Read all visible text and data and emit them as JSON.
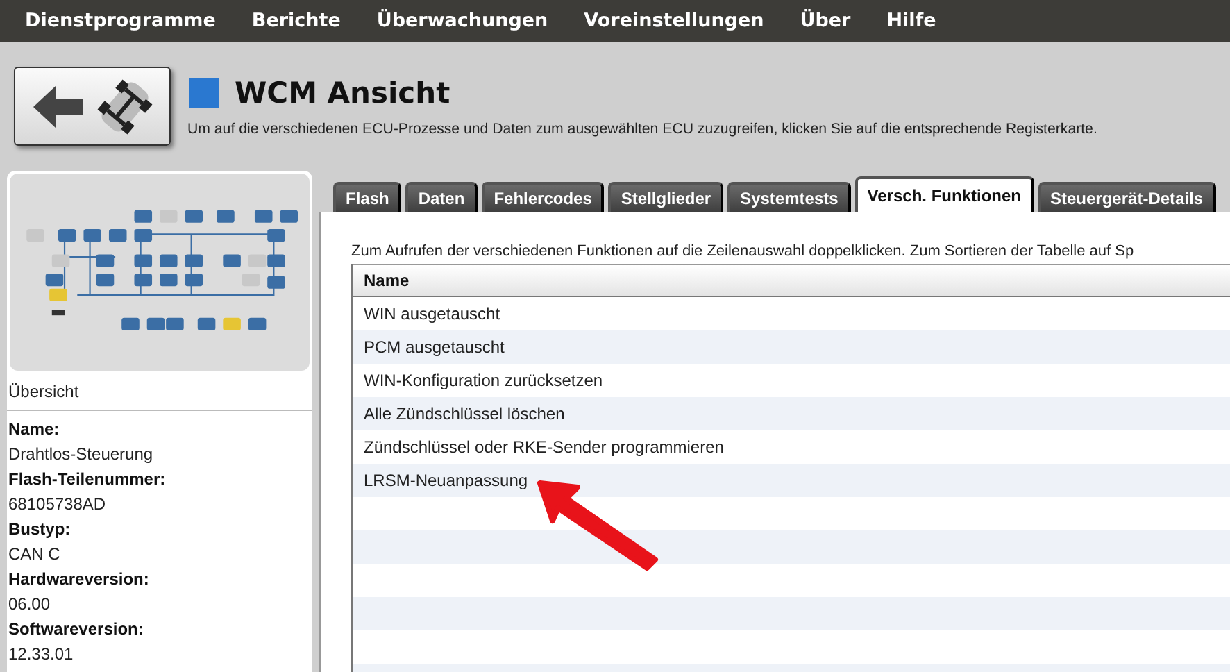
{
  "menu": [
    "Dienstprogramme",
    "Berichte",
    "Überwachungen",
    "Voreinstellungen",
    "Über",
    "Hilfe"
  ],
  "header": {
    "title": "WCM Ansicht",
    "description": "Um auf die verschiedenen ECU-Prozesse und Daten zum ausgewählten ECU zuzugreifen, klicken Sie auf die entsprechende Registerkarte."
  },
  "sidebar": {
    "caption": "Übersicht",
    "fields": [
      {
        "label": "Name:",
        "value": "Drahtlos-Steuerung"
      },
      {
        "label": "Flash-Teilenummer:",
        "value": "68105738AD"
      },
      {
        "label": "Bustyp:",
        "value": "CAN C"
      },
      {
        "label": "Hardwareversion:",
        "value": "06.00"
      },
      {
        "label": "Softwareversion:",
        "value": "12.33.01"
      }
    ]
  },
  "tabs": [
    {
      "label": "Flash",
      "selected": false
    },
    {
      "label": "Daten",
      "selected": false
    },
    {
      "label": "Fehlercodes",
      "selected": false
    },
    {
      "label": "Stellglieder",
      "selected": false
    },
    {
      "label": "Systemtests",
      "selected": false
    },
    {
      "label": "Versch. Funktionen",
      "selected": true
    },
    {
      "label": "Steuergerät-Details",
      "selected": false
    }
  ],
  "content": {
    "instruction": "Zum Aufrufen der verschiedenen Funktionen auf die Zeilenauswahl doppelklicken.  Zum Sortieren der Tabelle auf Sp",
    "table": {
      "columns": [
        "Name"
      ],
      "rows": [
        "WIN ausgetauscht",
        "PCM ausgetauscht",
        "WIN-Konfiguration zurücksetzen",
        "Alle Zündschlüssel löschen",
        "Zündschlüssel oder RKE-Sender programmieren",
        "LRSM-Neuanpassung"
      ]
    }
  }
}
